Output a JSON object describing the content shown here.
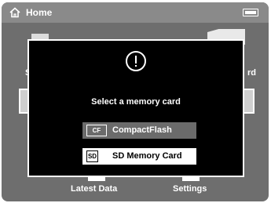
{
  "header": {
    "title": "Home",
    "home_icon": "home-icon",
    "battery_icon": "battery-icon"
  },
  "background": {
    "bottom_items": [
      {
        "label": "Latest Data"
      },
      {
        "label": "Settings"
      }
    ],
    "partial_left_label": "S",
    "partial_right_label": "rd"
  },
  "dialog": {
    "icon": "exclamation-icon",
    "message": "Select a memory card",
    "options": [
      {
        "icon_text": "CF",
        "label": "CompactFlash",
        "selected": false
      },
      {
        "icon_text": "SD",
        "label": "SD Memory Card",
        "selected": true
      }
    ]
  },
  "colors": {
    "screen_bg": "#6e6e6e",
    "topbar_bg": "#8a8a8a",
    "dialog_bg": "#000000",
    "option_bg": "#6b6b6b",
    "option_selected_bg": "#ffffff"
  }
}
